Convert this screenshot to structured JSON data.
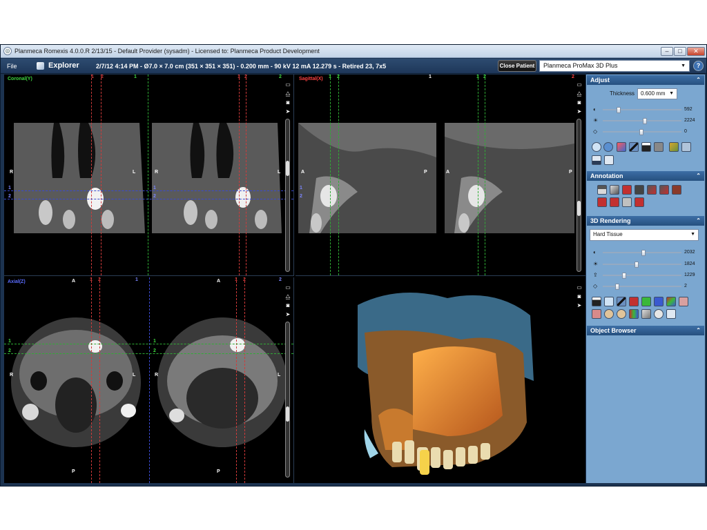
{
  "window": {
    "title": "Planmeca Romexis 4.0.0.R  2/13/15 - Default Provider (sysadm) - Licensed to: Planmeca Product Development",
    "minimize": "–",
    "maximize": "□",
    "close": "✕"
  },
  "menubar": {
    "file": "File",
    "explorer": "Explorer",
    "study_info": "2/7/12 4:14 PM - Ø7.0 × 7.0 cm (351 × 351 × 351) - 0.200 mm - 90 kV 12 mA 12.279 s - Retired 23, 7x5",
    "close_patient": "Close Patient",
    "device": "Planmeca ProMax 3D Plus",
    "help": "?"
  },
  "views": {
    "coronal": {
      "label": "Coronal(Y)",
      "left": "R",
      "right": "L",
      "marker1": "1",
      "marker2": "2"
    },
    "sagittal": {
      "label": "Sagittal(X)",
      "left": "A",
      "right": "P",
      "marker1": "1",
      "marker2": "2"
    },
    "axial": {
      "label": "Axial(Z)",
      "left": "R",
      "right": "L",
      "top": "A",
      "bottom": "P",
      "marker1": "1",
      "marker2": "2"
    }
  },
  "sidebar": {
    "adjust": {
      "title": "Adjust",
      "thickness_label": "Thickness",
      "thickness_value": "0.600 mm",
      "values": [
        "592",
        "2224",
        "0"
      ],
      "levels": [
        0.18,
        0.55,
        0.5
      ]
    },
    "annotation": {
      "title": "Annotation"
    },
    "rendering": {
      "title": "3D Rendering",
      "preset": "Hard Tissue",
      "values": [
        "2032",
        "1824",
        "1229",
        "2"
      ],
      "levels": [
        0.53,
        0.43,
        0.26,
        0.16
      ]
    },
    "object_browser": {
      "title": "Object Browser"
    },
    "collapse": "⌃"
  },
  "colors": {
    "coronal_label": "#3fd83f",
    "sagittal_label": "#ff4040",
    "axial_label": "#5a6cff",
    "line_green": "#2fae35",
    "line_red": "#d23a3a",
    "line_blue": "#3a4ad0"
  }
}
